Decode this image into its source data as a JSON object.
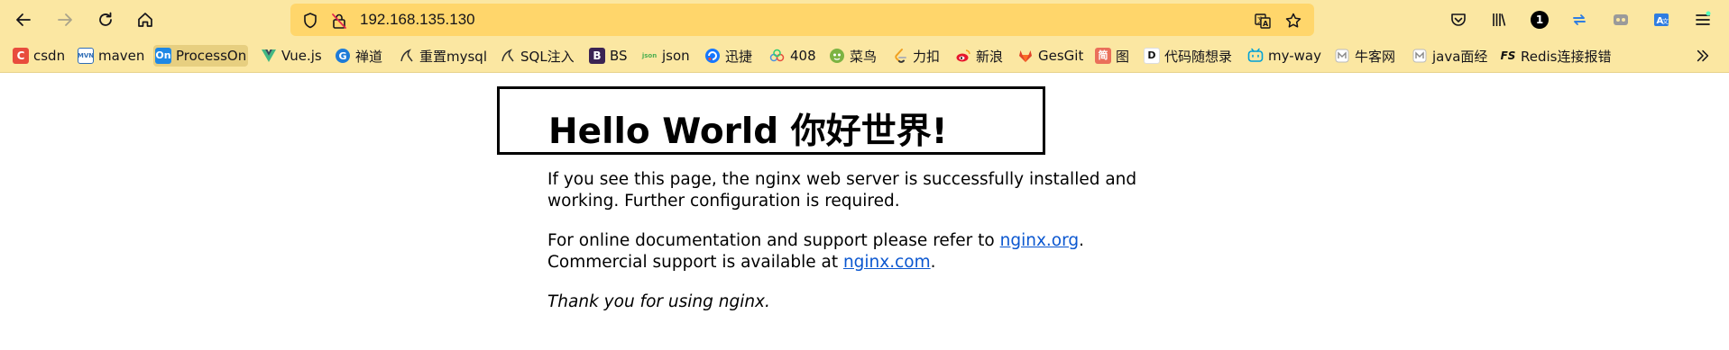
{
  "window": {
    "url": "192.168.135.130",
    "badge_count": "1"
  },
  "bookmarks": [
    {
      "label": "csdn",
      "icon": "csdn-icon",
      "fav_text": "C",
      "color": "#e84c3d"
    },
    {
      "label": "maven",
      "icon": "maven-icon",
      "fav_text": "MVN",
      "color": "#2f6db5"
    },
    {
      "label": "ProcessOn",
      "icon": "processon-icon",
      "fav_text": "On",
      "color": "#1e88e5"
    },
    {
      "label": "Vue.js",
      "icon": "vue-icon",
      "fav_text": "",
      "color": "#42b883"
    },
    {
      "label": "禅道",
      "icon": "zentao-icon",
      "fav_text": "",
      "color": "#1d7bd8"
    },
    {
      "label": "重置mysql",
      "icon": "mysql-icon",
      "fav_text": "",
      "color": "#333333"
    },
    {
      "label": "SQL注入",
      "icon": "sql-icon",
      "fav_text": "",
      "color": "#333333"
    },
    {
      "label": "BS",
      "icon": "bootstrap-icon",
      "fav_text": "B",
      "color": "#3b2453"
    },
    {
      "label": "json",
      "icon": "json-icon",
      "fav_text": "json",
      "color": "#4caf50"
    },
    {
      "label": "迅捷",
      "icon": "xunjie-icon",
      "fav_text": "",
      "color": "#1677ff"
    },
    {
      "label": "408",
      "icon": "cloud-icon",
      "fav_text": "",
      "color": "#4a90e2"
    },
    {
      "label": "菜鸟",
      "icon": "runoob-icon",
      "fav_text": "",
      "color": "#7cb342"
    },
    {
      "label": "力扣",
      "icon": "leetcode-icon",
      "fav_text": "",
      "color": "#f0a020"
    },
    {
      "label": "新浪",
      "icon": "weibo-icon",
      "fav_text": "",
      "color": "#e6162d"
    },
    {
      "label": "GesGit",
      "icon": "gitlab-icon",
      "fav_text": "",
      "color": "#e24329"
    },
    {
      "label": "图",
      "icon": "jian-icon",
      "fav_text": "简",
      "color": "#ea6f5a"
    },
    {
      "label": "代码随想录",
      "icon": "daima-icon",
      "fav_text": "D",
      "color": "#111111"
    },
    {
      "label": "my-way",
      "icon": "bilibili-icon",
      "fav_text": "",
      "color": "#00a1d6"
    },
    {
      "label": "牛客网",
      "icon": "nowcoder-icon",
      "fav_text": "",
      "color": "#999999"
    },
    {
      "label": "java面经",
      "icon": "nowcoder-icon",
      "fav_text": "",
      "color": "#999999"
    },
    {
      "label": "Redis连接报错",
      "icon": "fs-icon",
      "fav_text": "FS",
      "color": "#111111"
    }
  ],
  "page": {
    "title": "Hello World 你好世界!",
    "p1_line1": "If you see this page, the nginx web server is successfully installed and",
    "p1_line2": "working. Further configuration is required.",
    "p2_prefix": "For online documentation and support please refer to ",
    "p2_link": "nginx.org",
    "p2_suffix": ".",
    "p3_prefix": "Commercial support is available at ",
    "p3_link": "nginx.com",
    "p3_suffix": ".",
    "p4": "Thank you for using nginx."
  },
  "colors": {
    "toolbar_bg": "#fbe7a2",
    "urlbar_bg": "#ffd66b",
    "link": "#0b57d0"
  }
}
